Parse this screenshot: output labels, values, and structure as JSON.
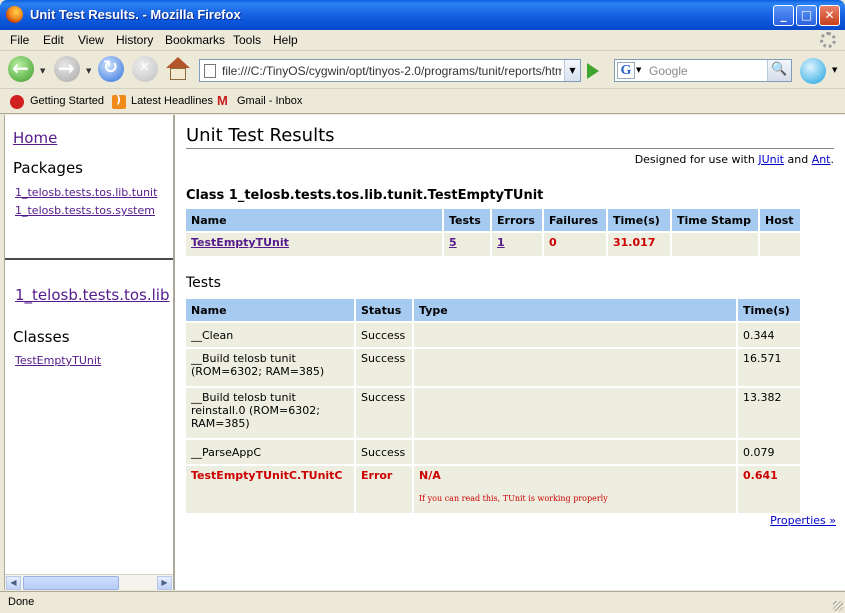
{
  "window": {
    "title": "Unit Test Results. - Mozilla Firefox"
  },
  "menu": [
    "File",
    "Edit",
    "View",
    "History",
    "Bookmarks",
    "Tools",
    "Help"
  ],
  "nav": {
    "url": "file:///C:/TinyOS/cygwin/opt/tinyos-2.0/programs/tunit/reports/html/in",
    "search_placeholder": "Google",
    "search_engine_letter": "G"
  },
  "bookmarks": [
    "Getting Started",
    "Latest Headlines",
    "Gmail - Inbox"
  ],
  "left": {
    "home": "Home",
    "packages_heading": "Packages",
    "packages": [
      "1_telosb.tests.tos.lib.tunit",
      "1_telosb.tests.tos.system"
    ],
    "package_title": "1_telosb.tests.tos.lib",
    "classes_heading": "Classes",
    "classes": [
      "TestEmptyTUnit"
    ]
  },
  "main": {
    "title": "Unit Test Results",
    "designed_prefix": "Designed for use with",
    "junit": "JUnit",
    "and": "and",
    "ant": "Ant",
    "period": ".",
    "class_heading": "Class 1_telosb.tests.tos.lib.tunit.TestEmptyTUnit",
    "summary_headers": [
      "Name",
      "Tests",
      "Errors",
      "Failures",
      "Time(s)",
      "Time Stamp",
      "Host"
    ],
    "summary_row": {
      "name": "TestEmptyTUnit",
      "tests": "5",
      "errors": "1",
      "failures": "0",
      "time": "31.017",
      "timestamp": "",
      "host": ""
    },
    "tests_heading": "Tests",
    "test_headers": [
      "Name",
      "Status",
      "Type",
      "Time(s)"
    ],
    "tests": [
      {
        "name": "__Clean",
        "status": "Success",
        "type": "",
        "time": "0.344"
      },
      {
        "name": "__Build telosb tunit (ROM=6302; RAM=385)",
        "status": "Success",
        "type": "",
        "time": "16.571"
      },
      {
        "name": "__Build telosb tunit reinstall.0 (ROM=6302; RAM=385)",
        "status": "Success",
        "type": "",
        "time": "13.382"
      },
      {
        "name": "__ParseAppC",
        "status": "Success",
        "type": "",
        "time": "0.079"
      }
    ],
    "error_test": {
      "name": "TestEmptyTUnitC.TUnitC",
      "status": "Error",
      "type": "N/A",
      "message": "If you can read this, TUnit is working properly",
      "time": "0.641"
    },
    "properties": "Properties »"
  },
  "status": "Done",
  "colors": {
    "header_bg": "#a6caf0",
    "row_bg": "#eeeee0",
    "error": "#cc0000",
    "titlebar": "#0a54d8"
  }
}
